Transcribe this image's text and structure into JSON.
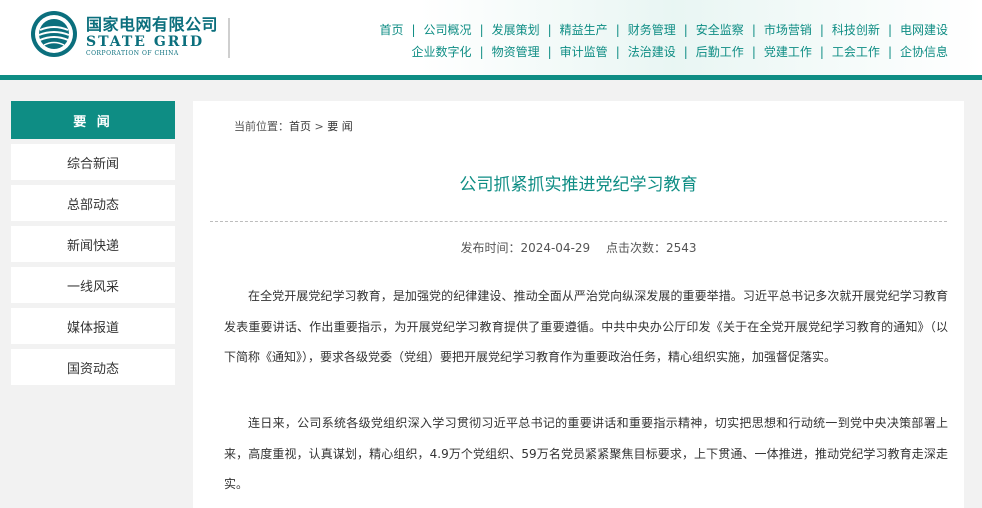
{
  "brand": {
    "name_cn": "国家电网有限公司",
    "name_en": "STATE GRID",
    "tagline": "CORPORATION OF CHINA",
    "accent_color": "#0e8d84"
  },
  "nav": {
    "row1": [
      "首页",
      "公司概况",
      "发展策划",
      "精益生产",
      "财务管理",
      "安全监察",
      "市场营销",
      "科技创新",
      "电网建设"
    ],
    "row2": [
      "企业数字化",
      "物资管理",
      "审计监管",
      "法治建设",
      "后勤工作",
      "党建工作",
      "工会工作",
      "企协信息"
    ]
  },
  "sidebar": {
    "heading": "要 闻",
    "items": [
      {
        "label": "综合新闻"
      },
      {
        "label": "总部动态"
      },
      {
        "label": "新闻快递"
      },
      {
        "label": "一线风采"
      },
      {
        "label": "媒体报道"
      },
      {
        "label": "国资动态"
      }
    ]
  },
  "breadcrumb": {
    "prefix": "当前位置：",
    "home": "首页",
    "sep": " > ",
    "current": "要 闻"
  },
  "article": {
    "title": "公司抓紧抓实推进党纪学习教育",
    "publish_time": "发布时间：2024-04-29",
    "views": "点击次数：2543",
    "paragraphs": [
      "在全党开展党纪学习教育，是加强党的纪律建设、推动全面从严治党向纵深发展的重要举措。习近平总书记多次就开展党纪学习教育发表重要讲话、作出重要指示，为开展党纪学习教育提供了重要遵循。中共中央办公厅印发《关于在全党开展党纪学习教育的通知》（以下简称《通知》），要求各级党委（党组）要把开展党纪学习教育作为重要政治任务，精心组织实施，加强督促落实。",
      "连日来，公司系统各级党组织深入学习贯彻习近平总书记的重要讲话和重要指示精神，切实把思想和行动统一到党中央决策部署上来，高度重视，认真谋划，精心组织，4.9万个党组织、59万名党员紧紧聚焦目标要求，上下贯通、一体推进，推动党纪学习教育走深走实。"
    ]
  }
}
